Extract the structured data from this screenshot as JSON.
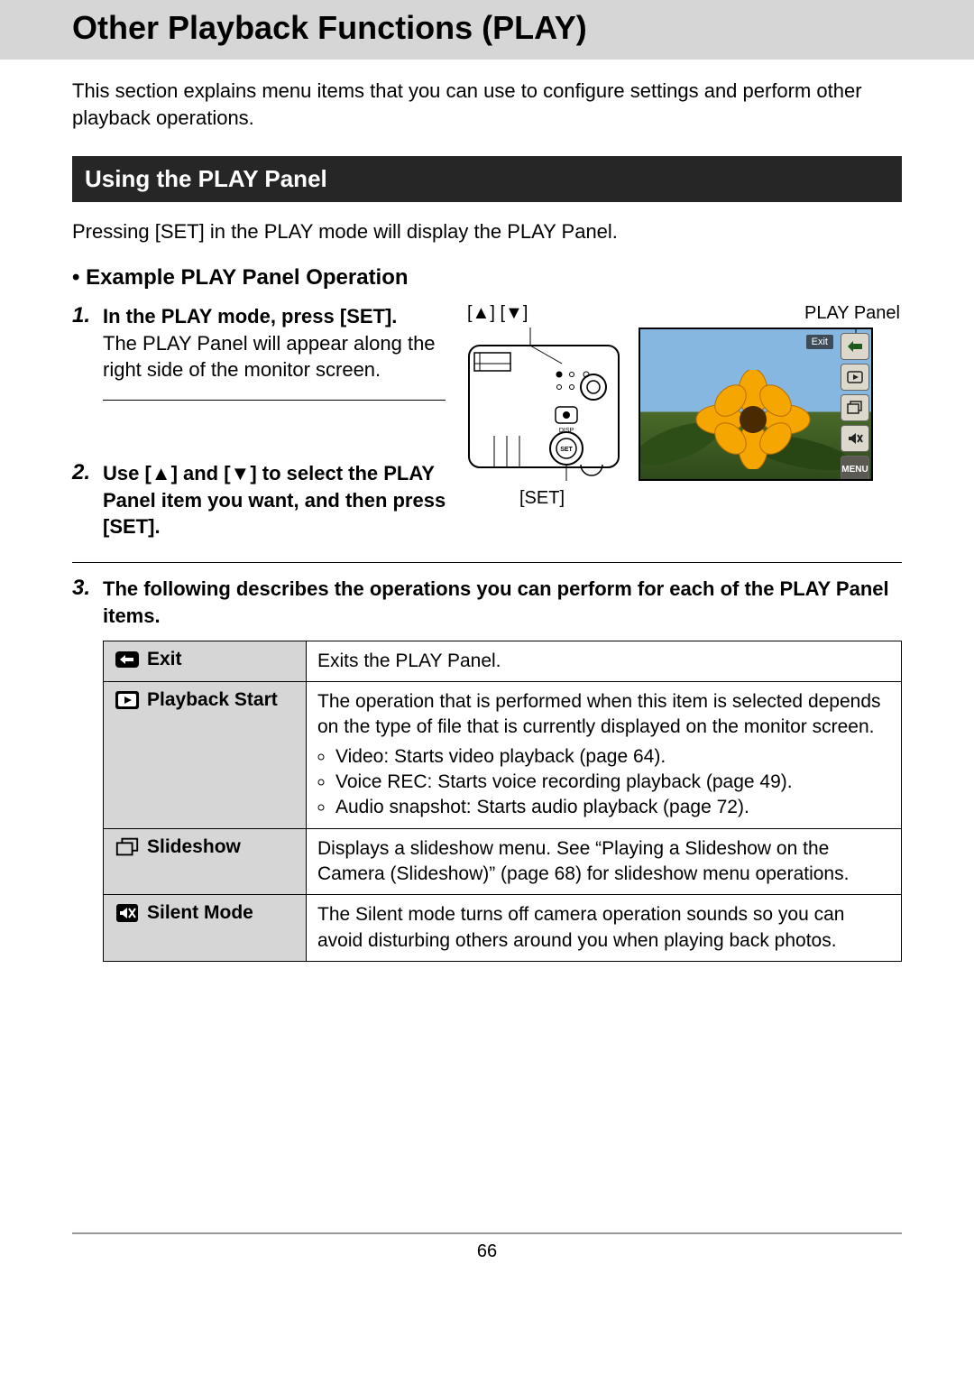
{
  "title": "Other Playback Functions (PLAY)",
  "intro": "This section explains menu items that you can use to configure settings and perform other playback operations.",
  "section_heading": "Using the PLAY Panel",
  "section_lead": "Pressing [SET] in the PLAY mode will display the PLAY Panel.",
  "example_heading_prefix": "•",
  "example_heading": "Example PLAY Panel Operation",
  "steps": {
    "s1": {
      "head": "In the PLAY mode, press [SET].",
      "sub": "The PLAY Panel will appear along the right side of the monitor screen."
    },
    "s2": {
      "head": "Use [▲] and [▼] to select the PLAY Panel item you want, and then press [SET]."
    },
    "s3": {
      "head": "The following describes the operations you can perform for each of the PLAY Panel items."
    }
  },
  "figure": {
    "arrows_label": "[▲] [▼]",
    "panel_label": "PLAY Panel",
    "set_label": "[SET]",
    "exit_overlay": "Exit",
    "menu_text": "MENU"
  },
  "table": {
    "rows": {
      "exit": {
        "label": "Exit",
        "desc": "Exits the PLAY Panel."
      },
      "playback": {
        "label": "Playback Start",
        "lead": "The operation that is performed when this item is selected depends on the type of file that is currently displayed on the monitor screen.",
        "b1": "Video: Starts video playback (page 64).",
        "b2": "Voice REC: Starts voice recording playback (page 49).",
        "b3": "Audio snapshot: Starts audio playback (page 72)."
      },
      "slideshow": {
        "label": "Slideshow",
        "desc": "Displays a slideshow menu. See “Playing a Slideshow on the Camera (Slideshow)” (page 68) for slideshow menu operations."
      },
      "silent": {
        "label": "Silent Mode",
        "desc": "The Silent mode turns off camera operation sounds so you can avoid disturbing others around you when playing back photos."
      }
    }
  },
  "page_number": "66"
}
